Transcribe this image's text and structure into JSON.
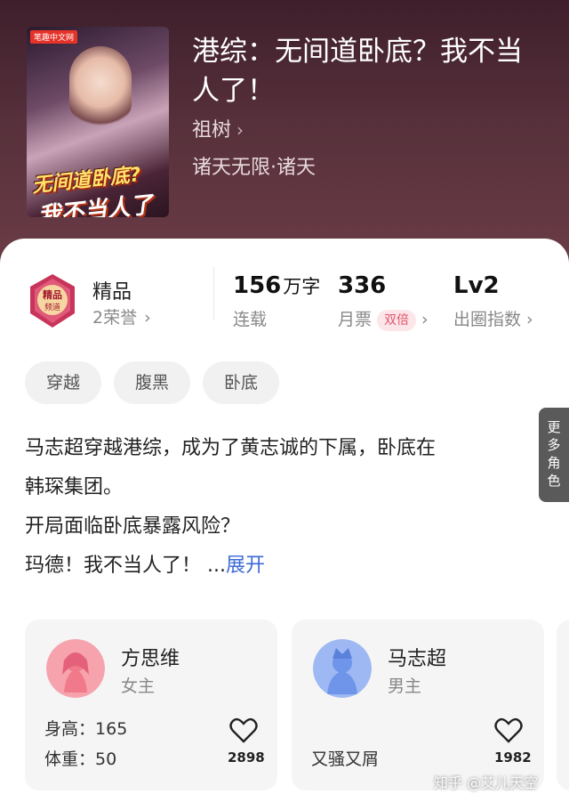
{
  "book": {
    "cover_badge": "笔趣中文网",
    "cover_title_line1": "无间道卧底?",
    "cover_title_line2": "我不当人了",
    "title": "港综：无间道卧底？我不当人了！",
    "author": "祖树",
    "genre": "诸天无限·诸天"
  },
  "stats": {
    "quality_label": "精品",
    "honors": "2荣誉",
    "word_count": "156",
    "word_unit": "万字",
    "status": "连载",
    "monthly_tickets": "336",
    "tickets_label": "月票",
    "double_badge": "双倍",
    "circle_level": "Lv2",
    "circle_label": "出圈指数"
  },
  "tags": [
    "穿越",
    "腹黑",
    "卧底"
  ],
  "description": {
    "line1": "马志超穿越港综，成为了黄志诚的下属，卧底在",
    "line2": "韩琛集团。",
    "line3": "开局面临卧底暴露风险？",
    "line4": "玛德！我不当人了！ ...",
    "expand_label": "展开"
  },
  "roles": [
    {
      "name": "方思维",
      "type": "女主",
      "height_label": "身高：",
      "height_value": "165",
      "weight_label": "体重：",
      "weight_value": "50",
      "likes": "2898",
      "avatar_color": "#f07a8a"
    },
    {
      "name": "马志超",
      "type": "男主",
      "trait": "又骚又屑",
      "likes": "1982",
      "avatar_color": "#6f95ea"
    }
  ],
  "more_roles_label": "更多角色",
  "watermark": "知乎 @艾儿天空"
}
